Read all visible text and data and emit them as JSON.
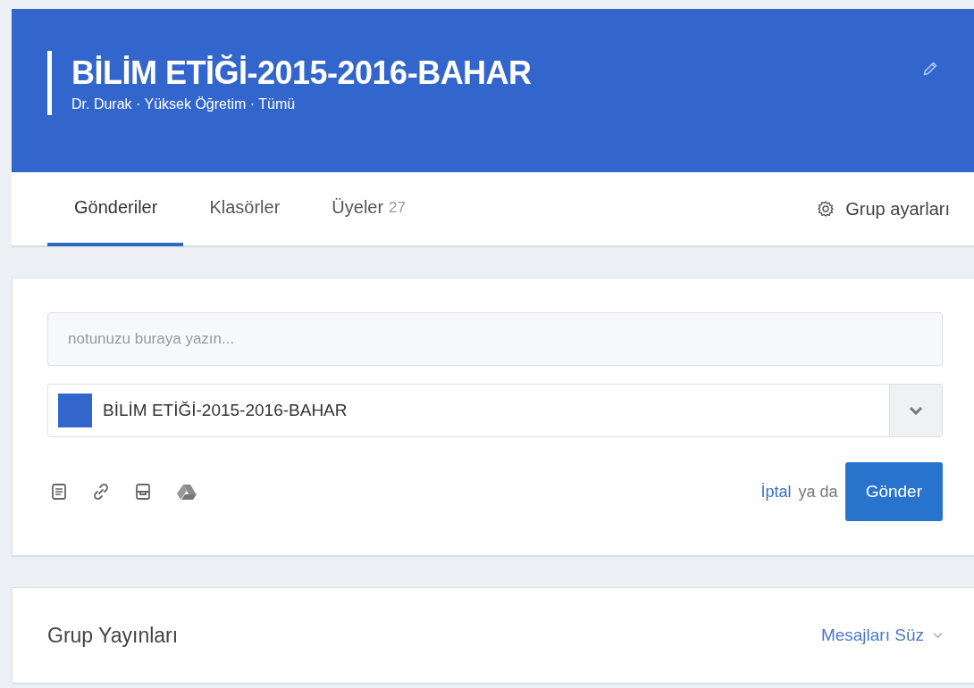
{
  "group": {
    "title": "BİLİM ETİĞİ-2015-2016-BAHAR",
    "meta": "Dr. Durak · Yüksek Öğretim · Tümü"
  },
  "tabs": [
    {
      "label": "Gönderiler",
      "selected": true
    },
    {
      "label": "Klasörler",
      "selected": false
    },
    {
      "label": "Üyeler",
      "count": "27",
      "selected": false
    }
  ],
  "settings_link": "Grup ayarları",
  "composer": {
    "placeholder": "notunuzu buraya yazın...",
    "recipient": {
      "label": "BİLİM ETİĞİ-2015-2016-BAHAR",
      "color": "#3366cc"
    },
    "cancel": "İptal",
    "or": "ya da",
    "submit": "Gönder"
  },
  "feed": {
    "title": "Grup Yayınları",
    "filter": "Mesajları Süz"
  }
}
